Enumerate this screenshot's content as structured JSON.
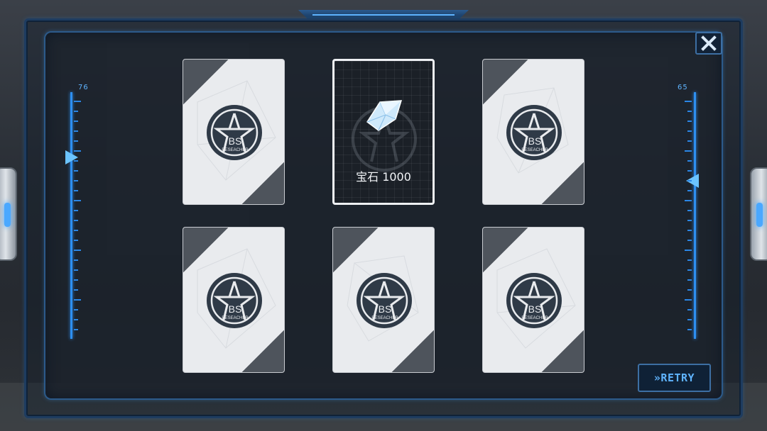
{
  "gauges": {
    "left_value": "76",
    "right_value": "65"
  },
  "close_button": {
    "icon": "close-icon"
  },
  "cards": [
    {
      "state": "back",
      "emblem_text": "BS",
      "emblem_subtext": "RESEACHER"
    },
    {
      "state": "revealed",
      "reward_icon": "gem-icon",
      "reward_label": "宝石",
      "reward_amount": "1000"
    },
    {
      "state": "back",
      "emblem_text": "BS",
      "emblem_subtext": "RESEACHER"
    },
    {
      "state": "back",
      "emblem_text": "BS",
      "emblem_subtext": "RESEACHER"
    },
    {
      "state": "back",
      "emblem_text": "BS",
      "emblem_subtext": "RESEACHER"
    },
    {
      "state": "back",
      "emblem_text": "BS",
      "emblem_subtext": "RESEACHER"
    }
  ],
  "retry_button": {
    "label": "»RETRY"
  },
  "colors": {
    "accent": "#5fb4ff",
    "frame": "#2c5a8a",
    "card_back": "#e9ebee",
    "card_stripe": "#4e545c"
  }
}
